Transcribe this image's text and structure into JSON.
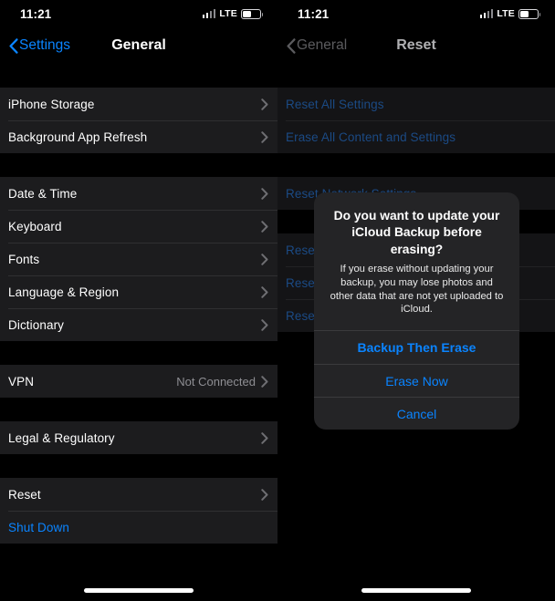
{
  "status_bar": {
    "time": "11:21",
    "network_label": "LTE",
    "signal_bars_filled": 2,
    "signal_bars_total": 4,
    "battery_level_percent": 52
  },
  "accent_color": "#0A84FF",
  "left_screen": {
    "nav": {
      "back_label": "Settings",
      "title": "General"
    },
    "groups": [
      {
        "rows": [
          {
            "label": "iPhone Storage",
            "chevron": true
          },
          {
            "label": "Background App Refresh",
            "chevron": true
          }
        ]
      },
      {
        "rows": [
          {
            "label": "Date & Time",
            "chevron": true
          },
          {
            "label": "Keyboard",
            "chevron": true
          },
          {
            "label": "Fonts",
            "chevron": true
          },
          {
            "label": "Language & Region",
            "chevron": true
          },
          {
            "label": "Dictionary",
            "chevron": true
          }
        ]
      },
      {
        "rows": [
          {
            "label": "VPN",
            "value": "Not Connected",
            "chevron": true
          }
        ]
      },
      {
        "rows": [
          {
            "label": "Legal & Regulatory",
            "chevron": true
          }
        ]
      },
      {
        "rows": [
          {
            "label": "Reset",
            "chevron": true
          },
          {
            "label": "Shut Down",
            "style": "blue",
            "chevron": false
          }
        ]
      }
    ]
  },
  "right_screen": {
    "nav": {
      "back_label": "General",
      "title": "Reset"
    },
    "groups": [
      {
        "rows": [
          {
            "label": "Reset All Settings"
          },
          {
            "label": "Erase All Content and Settings"
          }
        ]
      },
      {
        "rows": [
          {
            "label": "Reset Network Settings"
          }
        ]
      },
      {
        "rows": [
          {
            "label": "Reset Keyboard Dictionary"
          },
          {
            "label": "Reset Home Screen Layout"
          },
          {
            "label": "Reset Location & Privacy"
          }
        ]
      }
    ],
    "alert": {
      "title": "Do you want to update your iCloud Backup before erasing?",
      "message": "If you erase without updating your backup, you may lose photos and other data that are not yet uploaded to iCloud.",
      "buttons": [
        {
          "label": "Backup Then Erase",
          "emphasis": "bold"
        },
        {
          "label": "Erase Now",
          "emphasis": "normal"
        },
        {
          "label": "Cancel",
          "emphasis": "normal"
        }
      ]
    }
  }
}
